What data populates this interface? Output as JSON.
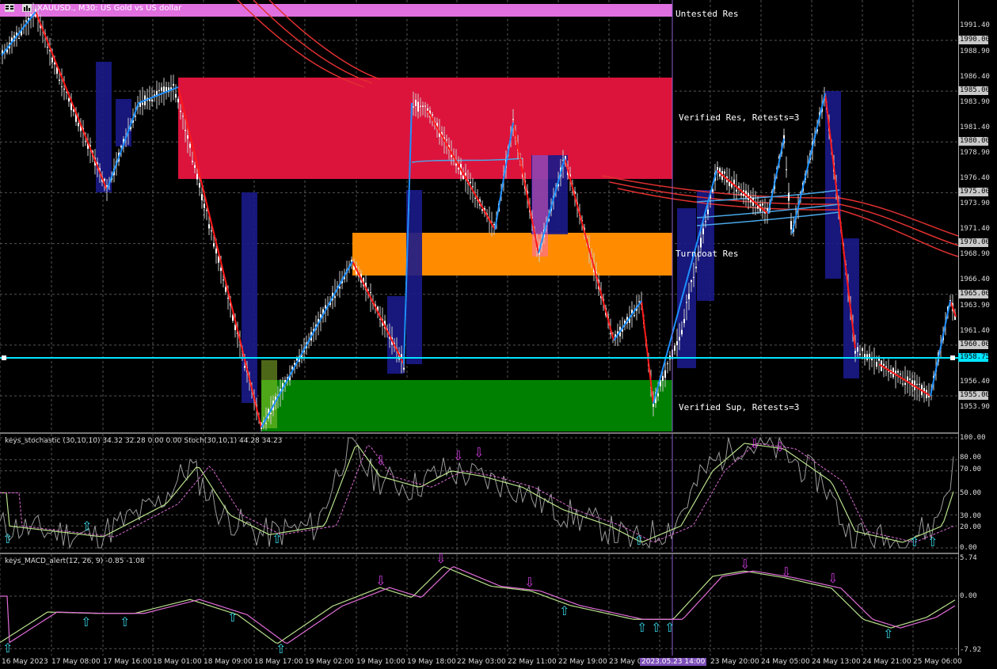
{
  "window": {
    "title": "XAUUSD., M30:  US Gold vs US dollar",
    "icons": [
      "chart-menu-icon",
      "one-click-trading-icon"
    ]
  },
  "price_axis": {
    "labels": [
      "1991.40",
      "1988.90",
      "1986.40",
      "1983.90",
      "1981.40",
      "1978.90",
      "1976.40",
      "1973.90",
      "1971.40",
      "1968.90",
      "1966.40",
      "1963.90",
      "1961.40",
      "1956.40",
      "1953.90"
    ],
    "boxed_labels": [
      "1990.00",
      "1985.00",
      "1980.00",
      "1975.00",
      "1970.00",
      "1965.00",
      "1960.00",
      "1955.00"
    ],
    "current_price": "1958.75"
  },
  "zones": [
    {
      "label": "Untested Res",
      "color": "#e070e0"
    },
    {
      "label": "Verified Res, Retests=3",
      "color": "#dc143c"
    },
    {
      "label": "Turncoat Res",
      "color": "#ff8c00"
    },
    {
      "label": "Verified Sup, Retests=3",
      "color": "#008000"
    }
  ],
  "stochastic": {
    "title": "keys_stochastic (30,10,10) 34.32 32.28 0.00 0.00 Stoch(30,10,1) 44.28 34.23",
    "levels": [
      "100.00",
      "80.00",
      "70.00",
      "50.00",
      "30.00",
      "20.00",
      "0.00"
    ]
  },
  "macd": {
    "title": "keys_MACD_alert(12, 26, 9) -0.85 -1.08",
    "levels": [
      "5.74",
      "0.00",
      "-7.92"
    ]
  },
  "time_axis": {
    "labels": [
      "16 May 2023",
      "17 May 08:00",
      "17 May 16:00",
      "18 May 01:00",
      "18 May 09:00",
      "18 May 17:00",
      "19 May 02:00",
      "19 May 10:00",
      "19 May 18:00",
      "22 May 03:00",
      "22 May 11:00",
      "22 May 19:00",
      "23 May 04:",
      "23 May 20:00",
      "24 May 05:00",
      "24 May 13:00",
      "24 May 21:00",
      "25 May 06:00"
    ],
    "highlight": "2023.05.23 14:00"
  },
  "colors": {
    "background": "#000000",
    "bull_candle": "#ffffff",
    "current_price_line": "#00e5ff",
    "zigzag_up": "#1e90ff",
    "zigzag_down": "#ff1a1a"
  }
}
